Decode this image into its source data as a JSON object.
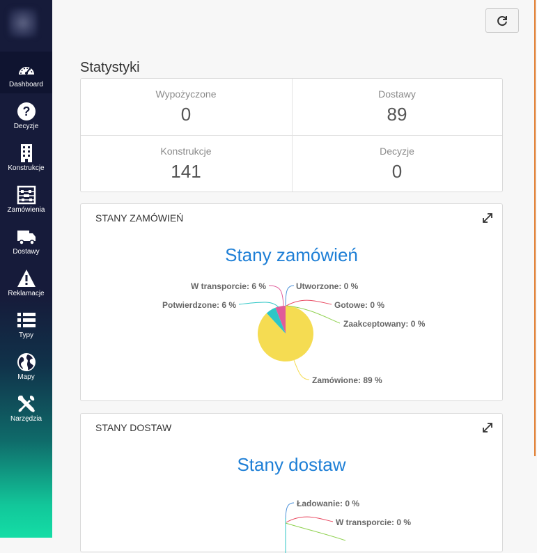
{
  "sidebar": {
    "items": [
      {
        "label": "Dashboard",
        "icon": "speedometer-icon",
        "active": true
      },
      {
        "label": "Decyzje",
        "icon": "question-icon"
      },
      {
        "label": "Konstrukcje",
        "icon": "building-icon"
      },
      {
        "label": "Zamówienia",
        "icon": "abacus-icon"
      },
      {
        "label": "Dostawy",
        "icon": "truck-icon"
      },
      {
        "label": "Reklamacje",
        "icon": "warning-icon"
      },
      {
        "label": "Typy",
        "icon": "list-icon"
      },
      {
        "label": "Mapy",
        "icon": "globe-icon"
      },
      {
        "label": "Narzędzia",
        "icon": "tools-icon"
      }
    ]
  },
  "header": {
    "refresh_icon": "refresh-icon"
  },
  "stats": {
    "title": "Statystyki",
    "items": [
      {
        "label": "Wypożyczone",
        "value": "0"
      },
      {
        "label": "Dostawy",
        "value": "89"
      },
      {
        "label": "Konstrukcje",
        "value": "141"
      },
      {
        "label": "Decyzje",
        "value": "0"
      }
    ]
  },
  "orders_panel": {
    "heading": "STANY ZAMÓWIEŃ",
    "chart_title": "Stany zamówień"
  },
  "deliveries_panel": {
    "heading": "STANY DOSTAW",
    "chart_title": "Stany dostaw"
  },
  "chart_data": [
    {
      "type": "pie",
      "title": "Stany zamówień",
      "slices": [
        {
          "label": "Utworzone: 0 %",
          "name": "Utworzone",
          "value": 0,
          "color": "#4a90d9"
        },
        {
          "label": "Gotowe: 0 %",
          "name": "Gotowe",
          "value": 0,
          "color": "#e8475f"
        },
        {
          "label": "Zaakceptowany: 0 %",
          "name": "Zaakceptowany",
          "value": 0,
          "color": "#8fd14f"
        },
        {
          "label": "Zamówione: 89 %",
          "name": "Zamówione",
          "value": 89,
          "color": "#f5dc52"
        },
        {
          "label": "Potwierdzone: 6 %",
          "name": "Potwierdzone",
          "value": 6,
          "color": "#2cc6c6"
        },
        {
          "label": "W transporcie: 6 %",
          "name": "W transporcie",
          "value": 6,
          "color": "#e05c9a"
        }
      ]
    },
    {
      "type": "pie",
      "title": "Stany dostaw",
      "slices": [
        {
          "label": "Ładowanie: 0 %",
          "name": "Ładowanie",
          "value": 0,
          "color": "#4a90d9"
        },
        {
          "label": "W transporcie: 0 %",
          "name": "W transporcie",
          "value": 0,
          "color": "#e8475f"
        }
      ]
    }
  ]
}
